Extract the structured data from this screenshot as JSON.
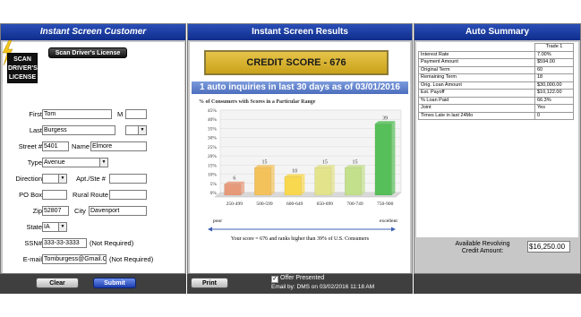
{
  "customer": {
    "title": "Instant Screen Customer",
    "scan_button": "Scan Driver's License",
    "scan_logo": [
      "SCAN",
      "DRIVER'S",
      "LICENSE"
    ],
    "labels": {
      "first": "First",
      "m": "M",
      "last": "Last",
      "street": "Street #",
      "name": "Name",
      "type": "Type",
      "direction": "Direction",
      "apt": "Apt./Ste #",
      "po_box": "PO Box",
      "rural_route": "Rural Route",
      "zip": "Zip",
      "city": "City",
      "state": "State",
      "ssn": "SSN#",
      "ssn_note": "(Not Required)",
      "email": "E-mail",
      "email_note": "(Not Required)"
    },
    "values": {
      "first": "Tom",
      "m": "",
      "last": "Burgess",
      "last_suffix": "",
      "street_num": "5401",
      "street_name": "Elmore",
      "type": "Avenue",
      "direction": "",
      "apt": "",
      "po_box": "",
      "rural_route": "",
      "zip": "52807",
      "city": "Davenport",
      "state": "IA",
      "ssn": "333-33-3333",
      "email": "Tomburgess@Gmail.C"
    },
    "clear_button": "Clear",
    "submit_button": "Submit"
  },
  "results": {
    "title": "Instant Screen Results",
    "credit_score_label": "CREDIT SCORE - 676",
    "inquiries_banner": "1 auto inquiries in last 30 days as of 03/01/2016",
    "chart_title": "% of Consumers with Scores in a Particular Range",
    "scale_left": "poor",
    "scale_right": "excellent",
    "score_statement": "Your score = 676 and ranks higher than 39% of U.S. Consumers",
    "print_button": "Print",
    "offer_presented": "Offer Presented",
    "email_by": "Email by: DMS  on 03/02/2016 11:18 AM",
    "colors": {
      "gold": "#d4b128",
      "banner": "#5f80c7"
    }
  },
  "chart_data": {
    "type": "bar",
    "title": "% of Consumers with Scores in a Particular Range",
    "categories": [
      "250-499",
      "500-599",
      "600-649",
      "650-699",
      "700-749",
      "750-900"
    ],
    "values": [
      6,
      15,
      10,
      15,
      15,
      39
    ],
    "yticks": [
      "0%",
      "5%",
      "10%",
      "15%",
      "20%",
      "25%",
      "30%",
      "35%",
      "40%",
      "45%"
    ],
    "ylim": [
      0,
      45
    ],
    "bar_colors": [
      "#e79a79",
      "#f4c25b",
      "#f8d84e",
      "#e3e38c",
      "#c3e08c",
      "#57bf59"
    ],
    "highlight_category": "650-699"
  },
  "summary": {
    "title": "Auto Summary",
    "column_header": "Trade 1",
    "rows": [
      [
        "Interest Rate",
        "7.00%"
      ],
      [
        "Payment Amount",
        "$594.00"
      ],
      [
        "Original Term",
        "60"
      ],
      [
        "Remaining Term",
        "18"
      ],
      [
        "Orig. Loan Amount",
        "$30,000.00"
      ],
      [
        "Est. Payoff",
        "$10,122.00"
      ],
      [
        "% Loan Paid",
        "66.3%"
      ],
      [
        "Joint",
        "Yes"
      ],
      [
        "Times Late in last 24Mo",
        "0"
      ]
    ],
    "revolving_label_1": "Available Revolving",
    "revolving_label_2": "Credit Amount:",
    "revolving_value": "$16,250.00"
  }
}
